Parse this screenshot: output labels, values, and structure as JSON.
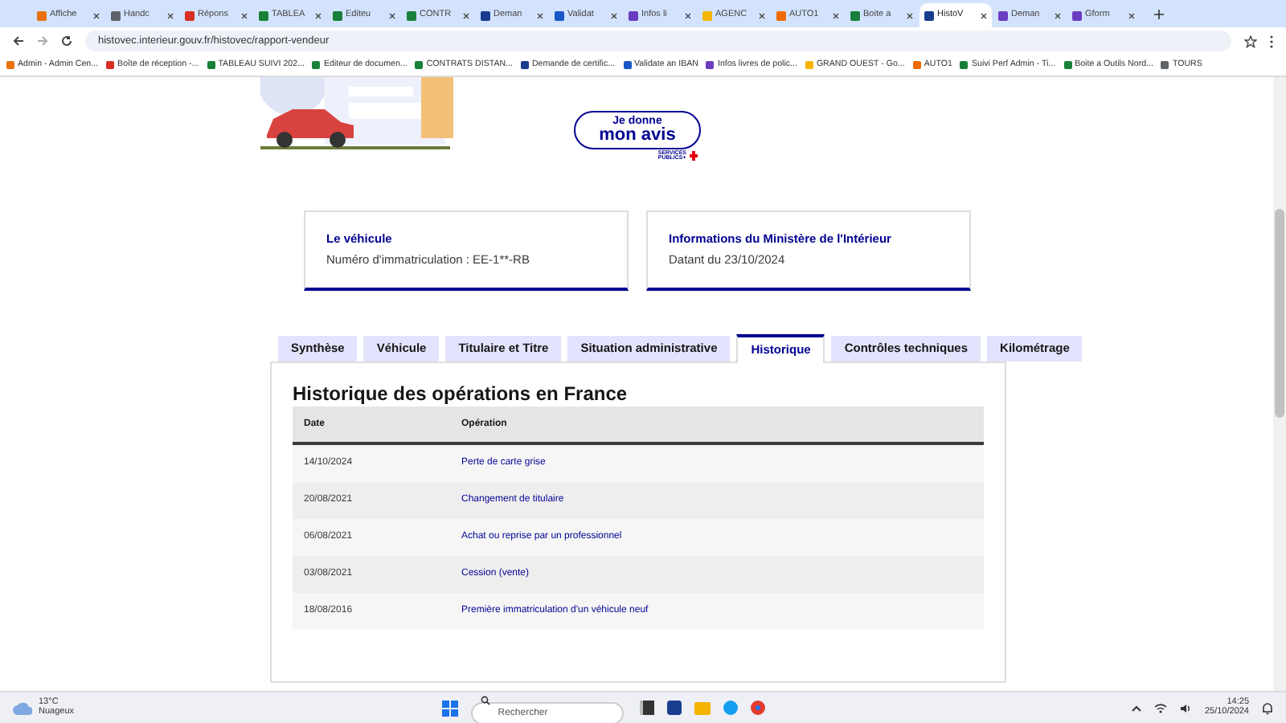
{
  "browser": {
    "tabs": [
      {
        "label": "Affiche",
        "color": "#e8710a",
        "selected": false
      },
      {
        "label": "Handc",
        "color": "#5f6368",
        "selected": false
      },
      {
        "label": "Répons",
        "color": "#d93025",
        "selected": false
      },
      {
        "label": "TABLEA",
        "color": "#188038",
        "selected": false
      },
      {
        "label": "Editeu",
        "color": "#188038",
        "selected": false
      },
      {
        "label": "CONTR",
        "color": "#188038",
        "selected": false
      },
      {
        "label": "Deman",
        "color": "#1a3c8f",
        "selected": false
      },
      {
        "label": "Validat",
        "color": "#1a56c4",
        "selected": false
      },
      {
        "label": "Infos li",
        "color": "#6a3dc0",
        "selected": false
      },
      {
        "label": "AGENC",
        "color": "#f4b400",
        "selected": false
      },
      {
        "label": "AUTO1",
        "color": "#f06a00",
        "selected": false
      },
      {
        "label": "Boite a",
        "color": "#188038",
        "selected": false
      },
      {
        "label": "HistoV",
        "color": "#1a3c8f",
        "selected": true
      },
      {
        "label": "Deman",
        "color": "#6a3dc0",
        "selected": false
      },
      {
        "label": "Gform",
        "color": "#6a3dc0",
        "selected": false
      }
    ],
    "url": "histovec.interieur.gouv.fr/histovec/rapport-vendeur",
    "bookmarks": [
      {
        "label": "Admin - Admin Cen...",
        "color": "#e8710a"
      },
      {
        "label": "Boîte de réception -...",
        "color": "#d93025"
      },
      {
        "label": "TABLEAU SUIVI 202...",
        "color": "#188038"
      },
      {
        "label": "Editeur de documen...",
        "color": "#188038"
      },
      {
        "label": "CONTRATS DISTAN...",
        "color": "#188038"
      },
      {
        "label": "Demande de certific...",
        "color": "#1a3c8f"
      },
      {
        "label": "Validate an IBAN",
        "color": "#1a56c4"
      },
      {
        "label": "Infos livres de polic...",
        "color": "#6a3dc0"
      },
      {
        "label": "GRAND OUEST - Go...",
        "color": "#f4b400"
      },
      {
        "label": "AUTO1",
        "color": "#f06a00"
      },
      {
        "label": "Suivi Perf Admin - Ti...",
        "color": "#188038"
      },
      {
        "label": "Boite a Outils Nord...",
        "color": "#188038"
      },
      {
        "label": "TOURS",
        "color": "#5f6368"
      }
    ]
  },
  "page": {
    "feedback": {
      "line1": "Je donne",
      "line2": "mon avis",
      "brand1": "SERVICES",
      "brand2": "PUBLICS+"
    },
    "cards": [
      {
        "title": "Le véhicule",
        "text": "Numéro d'immatriculation : EE-1**-RB"
      },
      {
        "title": "Informations du Ministère de l'Intérieur",
        "text": "Datant du 23/10/2024"
      }
    ],
    "tabs": [
      {
        "label": "Synthèse",
        "selected": false
      },
      {
        "label": "Véhicule",
        "selected": false
      },
      {
        "label": "Titulaire et Titre",
        "selected": false
      },
      {
        "label": "Situation administrative",
        "selected": false
      },
      {
        "label": "Historique",
        "selected": true
      },
      {
        "label": "Contrôles techniques",
        "selected": false
      },
      {
        "label": "Kilométrage",
        "selected": false
      }
    ],
    "heading": "Historique des opérations en France",
    "table": {
      "columns": [
        "Date",
        "Opération"
      ],
      "rows": [
        [
          "14/10/2024",
          "Perte de carte grise"
        ],
        [
          "20/08/2021",
          "Changement de titulaire"
        ],
        [
          "06/08/2021",
          "Achat ou reprise par un professionnel"
        ],
        [
          "03/08/2021",
          "Cession (vente)"
        ],
        [
          "18/08/2016",
          "Première immatriculation d'un véhicule neuf"
        ]
      ]
    }
  },
  "taskbar": {
    "temperature": "13°C",
    "weather": "Nuageux",
    "search_placeholder": "Rechercher",
    "time": "14:25",
    "date": "25/10/2024"
  }
}
